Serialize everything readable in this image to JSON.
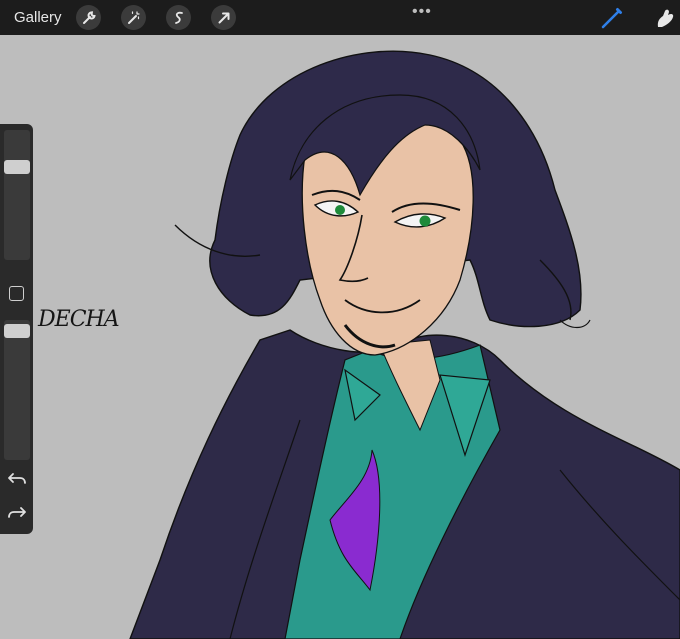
{
  "topbar": {
    "gallery_label": "Gallery",
    "tools": [
      "wrench-icon",
      "magic-wand-icon",
      "selection-icon",
      "transform-arrow-icon"
    ],
    "more_icon": "•••",
    "right_tools": [
      "brush-icon",
      "smudge-icon"
    ]
  },
  "sidebar": {
    "brush_size_level": 0.15,
    "opacity_level": 0.03,
    "modify_button": "square-icon",
    "undo_icon": "undo-icon",
    "redo_icon": "redo-icon"
  },
  "canvas": {
    "signature_text": "DECHA",
    "colors": {
      "background": "#bdbdbd",
      "hair": "#2e2a4a",
      "skin": "#e9c2a6",
      "shirt": "#2a9a8c",
      "jacket": "#2e2a48",
      "eyes": "#1e8a3a",
      "tie_purple": "#8a2bd0"
    }
  },
  "colors": {
    "toolbar_bg": "#1c1c1c",
    "accent_brush": "#2f7fe8"
  }
}
